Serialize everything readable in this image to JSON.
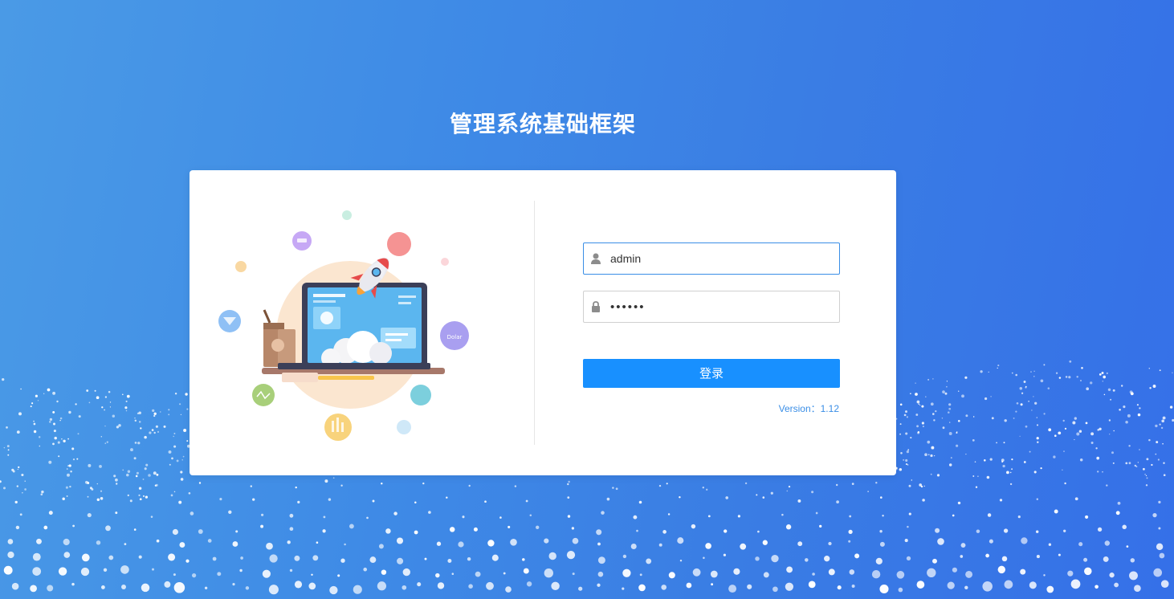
{
  "header": {
    "title": "管理系统基础框架"
  },
  "login_form": {
    "username": {
      "value": "admin",
      "icon": "user-icon"
    },
    "password": {
      "value": "••••••",
      "icon": "lock-icon"
    },
    "submit_label": "登录",
    "version_label": "Version：1.12"
  },
  "illustration": {
    "icon": "laptop-rocket-illustration",
    "dollar_bubble_text": "Dolar"
  },
  "colors": {
    "accent": "#1890ff",
    "link": "#3a8ee6",
    "background_start": "#4a9ae6",
    "background_end": "#3570e8"
  }
}
